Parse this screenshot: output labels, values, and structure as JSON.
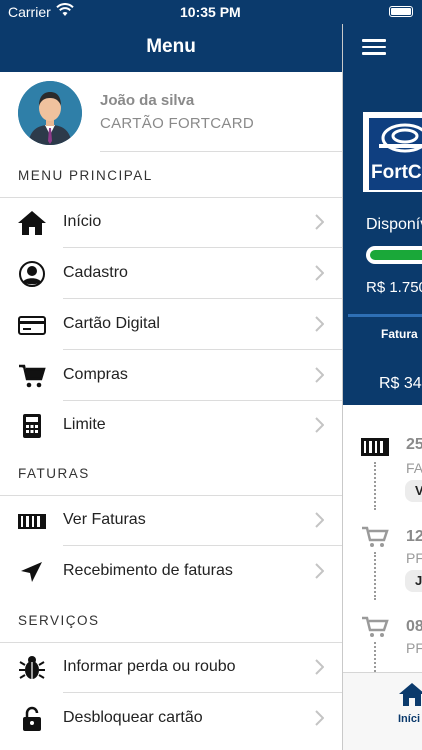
{
  "status_bar": {
    "carrier": "Carrier",
    "time": "10:35 PM",
    "icons": [
      "wifi-icon",
      "battery-icon"
    ]
  },
  "drawer": {
    "title": "Menu",
    "profile": {
      "name": "João da silva",
      "card": "CARTÃO FORTCARD"
    },
    "sections": [
      {
        "title": "MENU PRINCIPAL",
        "items": [
          {
            "label": "Início",
            "icon": "home-icon"
          },
          {
            "label": "Cadastro",
            "icon": "user-circle-icon"
          },
          {
            "label": "Cartão Digital",
            "icon": "credit-card-icon"
          },
          {
            "label": "Compras",
            "icon": "cart-icon"
          },
          {
            "label": "Limite",
            "icon": "calculator-icon"
          }
        ]
      },
      {
        "title": "FATURAS",
        "items": [
          {
            "label": "Ver Faturas",
            "icon": "barcode-icon"
          },
          {
            "label": "Recebimento de faturas",
            "icon": "send-icon"
          }
        ]
      },
      {
        "title": "SERVIÇOS",
        "items": [
          {
            "label": "Informar perda ou roubo",
            "icon": "bug-icon"
          },
          {
            "label": "Desbloquear cartão",
            "icon": "lock-icon"
          }
        ]
      }
    ]
  },
  "main": {
    "logo_text": "FortC",
    "available_label": "Disponív",
    "limit_value": "R$ 1.750",
    "tab_label": "Fatura",
    "fatura_value": "R$ 34",
    "timeline": [
      {
        "date": "25",
        "desc": "FA",
        "badge": "V",
        "icon": "barcode-icon"
      },
      {
        "date": "12",
        "desc": "PF",
        "badge": "J",
        "icon": "cart-icon"
      },
      {
        "date": "08",
        "desc": "PF",
        "badge": "",
        "icon": "cart-icon"
      }
    ],
    "bottom_tab_label": "Iníci",
    "colors": {
      "primary": "#0b3a6c",
      "accent_green": "#1aa839"
    }
  }
}
